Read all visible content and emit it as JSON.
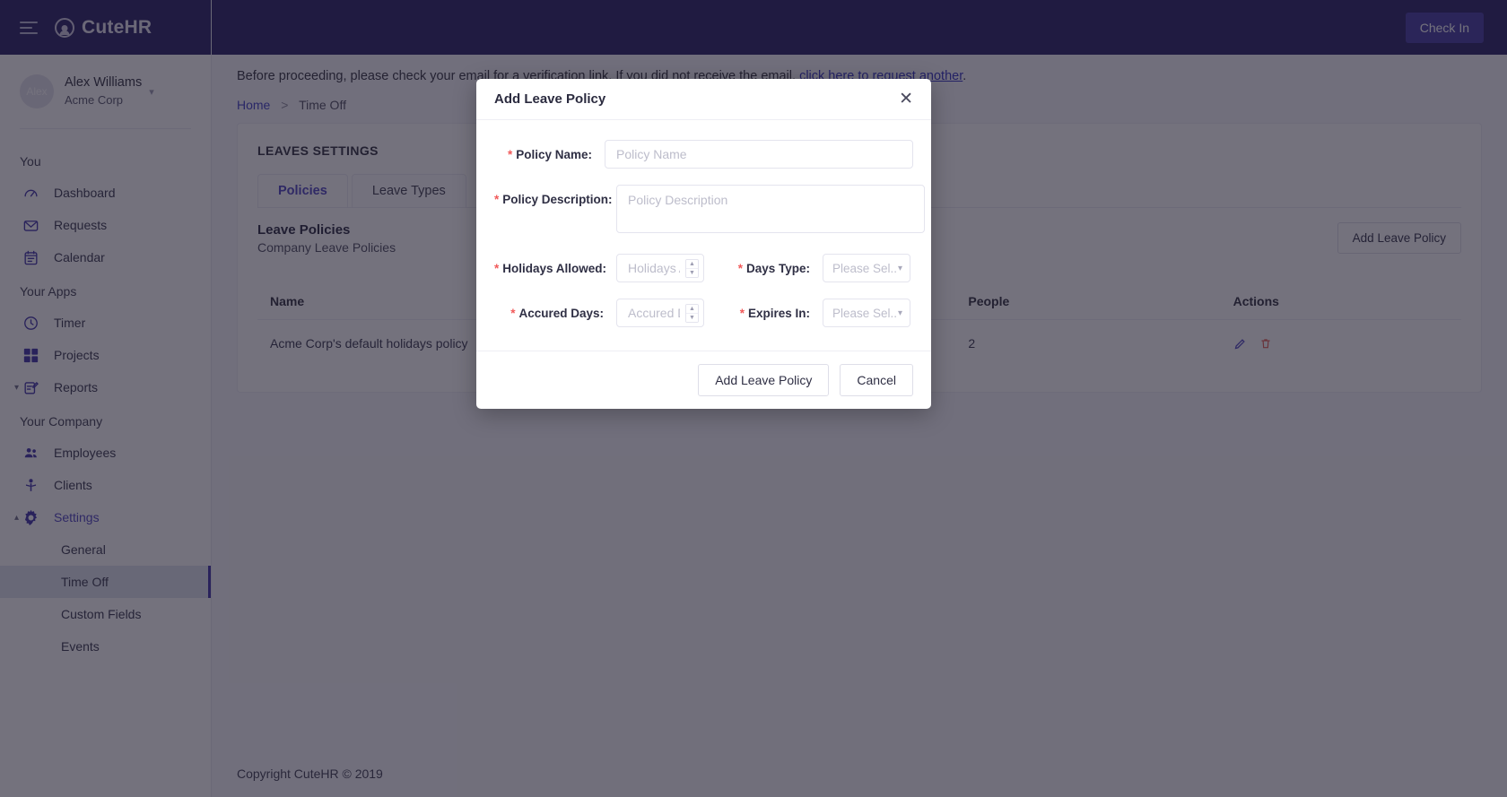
{
  "colors": {
    "brand_navy": "#241c61",
    "accent_purple": "#4a3fbf",
    "required_red": "#f15a5a",
    "link_blue": "#2d2dc0",
    "selected_row": "#dfe5ee"
  },
  "sidebar": {
    "brand": "CuteHR",
    "user": {
      "avatar_initials": "Alex",
      "name": "Alex Williams",
      "org": "Acme Corp"
    },
    "groups": [
      {
        "label": "You",
        "items": [
          {
            "label": "Dashboard",
            "icon": "dashboard-icon"
          },
          {
            "label": "Requests",
            "icon": "envelope-icon"
          },
          {
            "label": "Calendar",
            "icon": "calendar-icon"
          }
        ]
      },
      {
        "label": "Your Apps",
        "items": [
          {
            "label": "Timer",
            "icon": "clock-icon"
          },
          {
            "label": "Projects",
            "icon": "grid-icon"
          },
          {
            "label": "Reports",
            "icon": "report-icon",
            "expandable": true,
            "expanded": false
          }
        ]
      },
      {
        "label": "Your Company",
        "items": [
          {
            "label": "Employees",
            "icon": "people-icon"
          },
          {
            "label": "Clients",
            "icon": "person-icon"
          },
          {
            "label": "Settings",
            "icon": "gear-icon",
            "expandable": true,
            "expanded": true,
            "active": true
          }
        ]
      }
    ],
    "settings_subitems": [
      {
        "label": "General",
        "selected": false
      },
      {
        "label": "Time Off",
        "selected": true
      },
      {
        "label": "Custom Fields",
        "selected": false
      },
      {
        "label": "Events",
        "selected": false
      }
    ]
  },
  "topbar": {
    "check_in_label": "Check In"
  },
  "banner": {
    "text_before": "Before proceeding, please check your email for a verification link. If you did not receive the email,",
    "link_text": "click here to request another",
    "text_after": "."
  },
  "breadcrumb": {
    "home": "Home",
    "separator": ">",
    "current": "Time Off"
  },
  "content": {
    "settings_title": "LEAVES SETTINGS",
    "tabs": [
      {
        "label": "Policies",
        "active": true
      },
      {
        "label": "Leave Types",
        "active": false
      }
    ],
    "section_title": "Leave Policies",
    "section_subtitle": "Company Leave Policies",
    "add_policy_button": "Add Leave Policy",
    "table": {
      "columns": [
        "Name",
        "People",
        "Actions"
      ],
      "rows": [
        {
          "name": "Acme Corp's default holidays policy",
          "people": "2",
          "actions": [
            "edit-icon",
            "delete-icon"
          ]
        }
      ]
    }
  },
  "footer": {
    "copyright": "Copyright CuteHR © 2019"
  },
  "modal": {
    "title": "Add Leave Policy",
    "close_icon": "close-icon",
    "fields": {
      "policy_name": {
        "label": "Policy Name:",
        "placeholder": "Policy Name",
        "value": "",
        "required": true
      },
      "policy_description": {
        "label": "Policy Description:",
        "placeholder": "Policy Description",
        "value": "",
        "required": true
      },
      "holidays_allowed": {
        "label": "Holidays Allowed:",
        "placeholder": "Holidays Allowed",
        "value": "",
        "required": true
      },
      "days_type": {
        "label": "Days Type:",
        "placeholder": "Please Sel...",
        "value": "",
        "required": true
      },
      "accured_days": {
        "label": "Accured Days:",
        "placeholder": "Accured Days",
        "value": "",
        "required": true
      },
      "expires_in": {
        "label": "Expires In:",
        "placeholder": "Please Sel...",
        "value": "",
        "required": true
      }
    },
    "buttons": {
      "submit": "Add Leave Policy",
      "cancel": "Cancel"
    }
  }
}
